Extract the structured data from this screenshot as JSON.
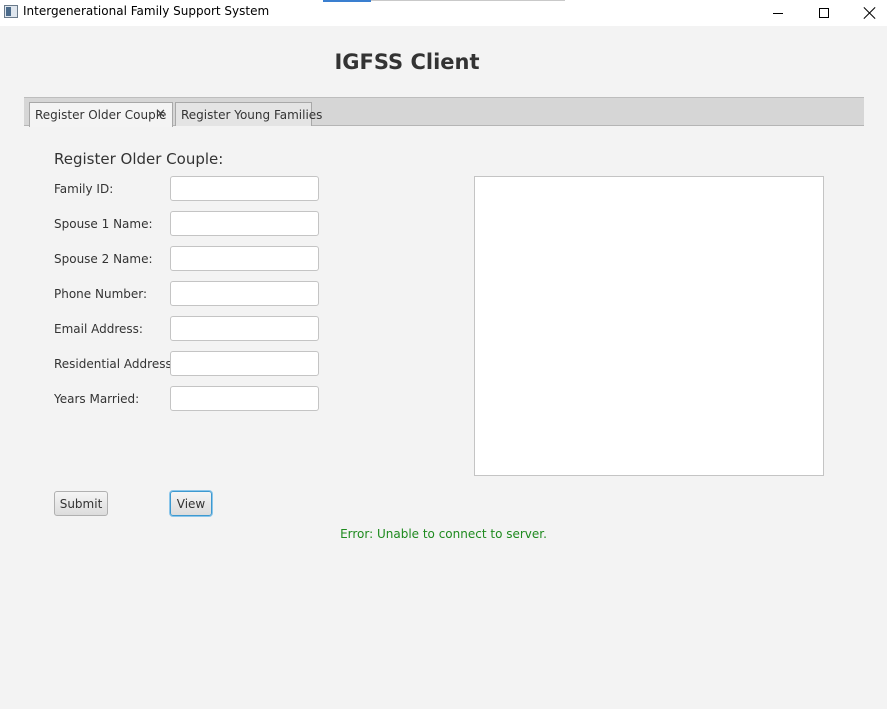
{
  "window": {
    "title": "Intergenerational Family Support System"
  },
  "app": {
    "title": "IGFSS Client"
  },
  "tabs": [
    {
      "label": "Register Older Couple",
      "selected": true,
      "closable": true
    },
    {
      "label": "Register Young Families",
      "selected": false,
      "closable": false
    }
  ],
  "form": {
    "heading": "Register Older Couple:",
    "fields": [
      {
        "label": "Family ID:",
        "value": ""
      },
      {
        "label": "Spouse 1 Name:",
        "value": ""
      },
      {
        "label": "Spouse 2 Name:",
        "value": ""
      },
      {
        "label": "Phone Number:",
        "value": ""
      },
      {
        "label": "Email Address:",
        "value": ""
      },
      {
        "label": "Residential Address:",
        "value": ""
      },
      {
        "label": "Years Married:",
        "value": ""
      }
    ]
  },
  "output": {
    "text": ""
  },
  "buttons": {
    "submit_label": "Submit",
    "view_label": "View"
  },
  "status": {
    "message": "Error: Unable to connect to server.",
    "color": "#1e8a1e"
  },
  "icons": {
    "app": "app-window-icon",
    "minimize": "minimize-icon",
    "maximize": "maximize-icon",
    "close": "close-icon",
    "tab_close": "close-tab-icon"
  }
}
